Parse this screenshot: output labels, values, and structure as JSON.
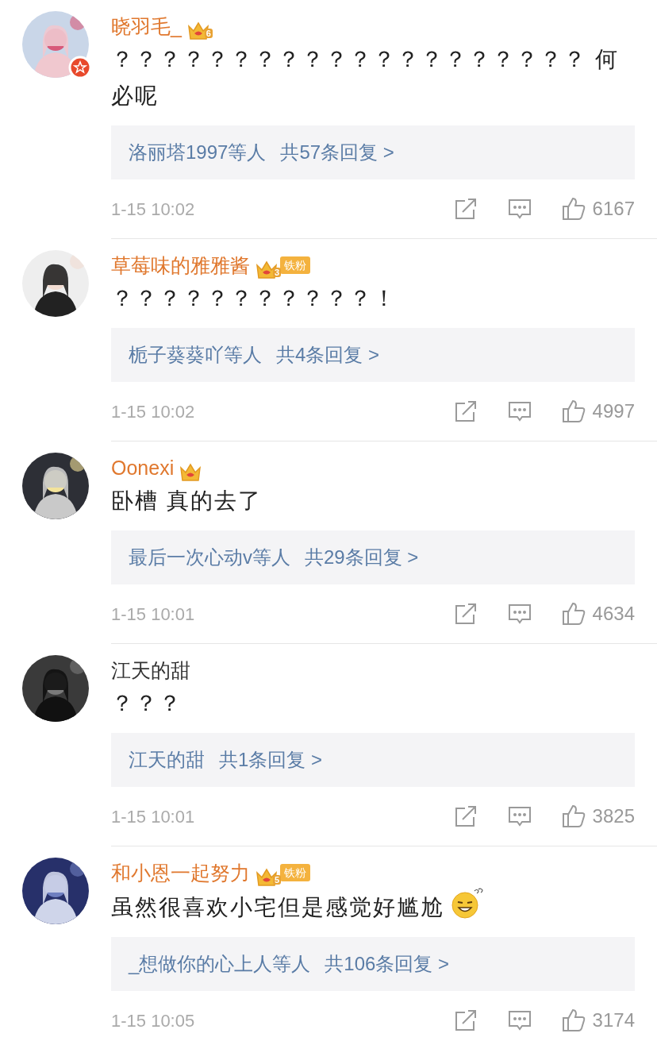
{
  "comments": [
    {
      "user": "晓羽毛_",
      "member": true,
      "verified": true,
      "crown": true,
      "level": "6",
      "text": "？？？？？？？？？？？？？？？？？？？？ 何必呢",
      "replies": {
        "names": "洛丽塔1997等人",
        "count": "共57条回复 >"
      },
      "time": "1-15 10:02",
      "likes": "6167"
    },
    {
      "user": "草莓味的雅雅酱",
      "member": true,
      "crown": true,
      "level": "3",
      "fan_tag": "铁粉",
      "text": "？？？？？？？？？？？！",
      "replies": {
        "names": "栀子葵葵吖等人",
        "count": "共4条回复 >"
      },
      "time": "1-15 10:02",
      "likes": "4997"
    },
    {
      "user": "Oonexi",
      "member": true,
      "crown": true,
      "text": "卧槽 真的去了",
      "replies": {
        "names": "最后一次心动v等人",
        "count": "共29条回复 >"
      },
      "time": "1-15 10:01",
      "likes": "4634"
    },
    {
      "user": "江天的甜",
      "member": false,
      "text": "？？？",
      "replies": {
        "names": "江天的甜",
        "count": "共1条回复 >"
      },
      "time": "1-15 10:01",
      "likes": "3825"
    },
    {
      "user": "和小恩一起努力",
      "member": true,
      "crown": true,
      "level": "5",
      "fan_tag": "铁粉",
      "text": "虽然很喜欢小宅但是感觉好尴尬",
      "emoji": true,
      "replies": {
        "names": "_想做你的心上人等人",
        "count": "共106条回复 >"
      },
      "time": "1-15 10:05",
      "likes": "3174"
    }
  ]
}
